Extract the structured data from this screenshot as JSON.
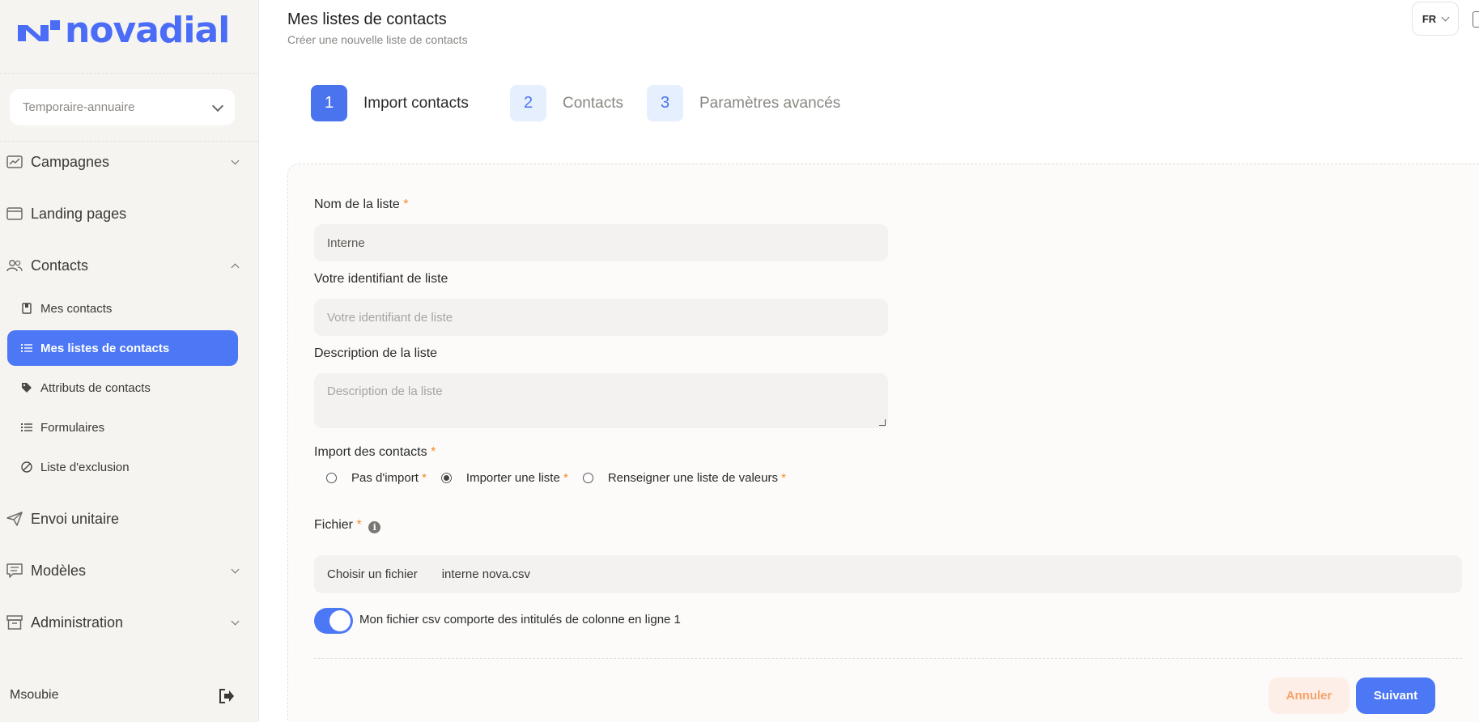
{
  "brand": {
    "name": "novadial",
    "color": "#4a6cf7"
  },
  "workspace": {
    "selected": "Temporaire-annuaire"
  },
  "sidebar": {
    "campagnes": "Campagnes",
    "landing": "Landing pages",
    "contacts": "Contacts",
    "sub": {
      "mes_contacts": "Mes contacts",
      "mes_listes": "Mes listes de contacts",
      "attributs": "Attributs de contacts",
      "formulaires": "Formulaires",
      "exclusion": "Liste d'exclusion"
    },
    "envoi": "Envoi unitaire",
    "modeles": "Modèles",
    "administration": "Administration",
    "user": "Msoubie"
  },
  "header": {
    "title": "Mes listes de contacts",
    "subtitle": "Créer une nouvelle liste de contacts",
    "lang": "FR"
  },
  "steps": [
    {
      "num": "1",
      "label": "Import contacts",
      "active": true
    },
    {
      "num": "2",
      "label": "Contacts",
      "active": false
    },
    {
      "num": "3",
      "label": "Paramètres avancés",
      "active": false
    }
  ],
  "form": {
    "name_label": "Nom de la liste",
    "name_value": "Interne",
    "id_label": "Votre identifiant de liste",
    "id_placeholder": "Votre identifiant de liste",
    "desc_label": "Description de la liste",
    "desc_placeholder": "Description de la liste",
    "import_label": "Import des contacts",
    "radio_none": "Pas d'import",
    "radio_list": "Importer une liste",
    "radio_values": "Renseigner une liste de valeurs",
    "file_label": "Fichier",
    "file_button": "Choisir un fichier",
    "file_name": "interne nova.csv",
    "toggle_label": "Mon fichier csv comporte des intitulés de colonne en ligne 1",
    "required_mark": "*",
    "info_glyph": "i"
  },
  "actions": {
    "cancel": "Annuler",
    "next": "Suivant"
  },
  "colors": {
    "primary": "#4d78f5",
    "required": "#f28c28",
    "cancel_text": "#f5a36a"
  }
}
